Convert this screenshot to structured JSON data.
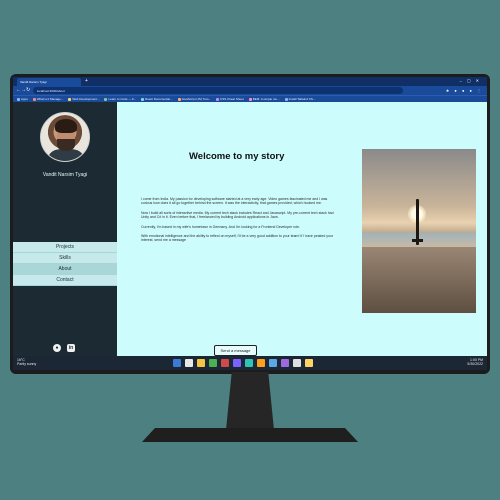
{
  "browser": {
    "tab_title": "Vandit Narsim Tyagi",
    "url": "localhost:3000/about",
    "bookmarks": [
      {
        "label": "Apps",
        "color": "#8ab4f8"
      },
      {
        "label": "What is it Manage...",
        "color": "#f28b82"
      },
      {
        "label": "Web Development...",
        "color": "#fdd663"
      },
      {
        "label": "Learn to Code — F...",
        "color": "#81c995"
      },
      {
        "label": "React Documentat...",
        "color": "#78d9ec"
      },
      {
        "label": "JavaScript (JS) Tuto...",
        "color": "#fcad70"
      },
      {
        "label": "CSS Cheat Sheet",
        "color": "#c58af9"
      },
      {
        "label": "BEM: A simple mo...",
        "color": "#ff8bcb"
      },
      {
        "label": "Install Tailwind CS...",
        "color": "#8ab4f8"
      }
    ]
  },
  "sidebar": {
    "name": "Vandit Narsim Tyagi",
    "nav": [
      {
        "label": "Projects"
      },
      {
        "label": "Skills"
      },
      {
        "label": "About"
      },
      {
        "label": "Contact"
      }
    ],
    "social": {
      "github": "github-icon",
      "linkedin": "in"
    }
  },
  "main": {
    "heading": "Welcome to my story",
    "paragraphs": [
      "I come from India. My passion for developing software started at a very early age. Video games fascinated me and I was curious how does it all go together behind the screen. It was the interactivity, that games provided, which hooked me.",
      "Now I build all sorts of interactive media. My current tech stack includes React and Javascript. My pre-current tech stack had Unity and C# in it. Even before that, I freelanced by building Android applications in Java.",
      "Currently, I'm based in my wife's hometown in Germany. And I'm looking for a Frontend Developer role.",
      "With emotional intelligence and the ability to reflect on myself, I'll be a very good addition to your team! If I have peaked your interest, send me a message"
    ],
    "send_button": "Send a message"
  },
  "taskbar": {
    "weather_temp": "16°C",
    "weather_desc": "Partly sunny",
    "time": "1:00 PM",
    "date": "5/30/2022",
    "app_colors": [
      "#3a7bd5",
      "#e8e8e8",
      "#f5c542",
      "#4caf50",
      "#d04a4a",
      "#7b61ff",
      "#2ec4b6",
      "#ff9f1c",
      "#5aa9e6",
      "#9c6ade",
      "#e0e0e0",
      "#ffd166"
    ]
  }
}
